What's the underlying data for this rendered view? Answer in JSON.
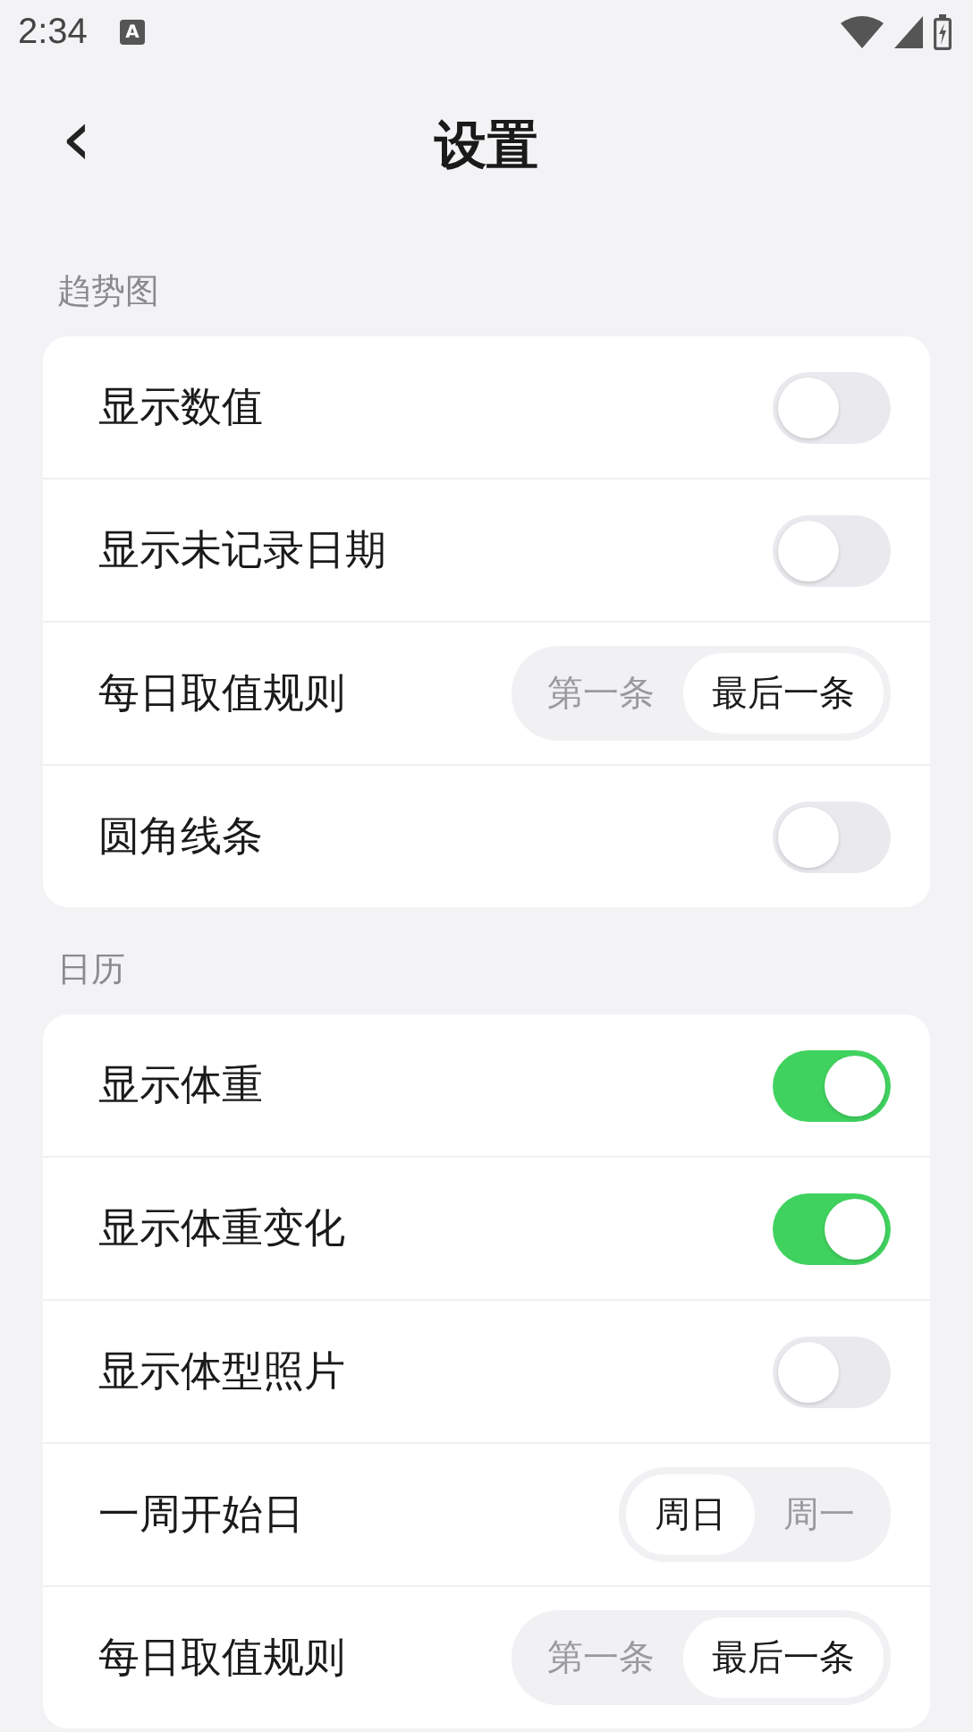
{
  "status_bar": {
    "time": "2:34",
    "notice_letter": "A"
  },
  "header": {
    "back": "‹",
    "title": "设置"
  },
  "sections": [
    {
      "title": "趋势图",
      "rows": [
        {
          "kind": "toggle",
          "label": "显示数值",
          "on": false
        },
        {
          "kind": "toggle",
          "label": "显示未记录日期",
          "on": false
        },
        {
          "kind": "segment",
          "label": "每日取值规则",
          "options": [
            {
              "label": "第一条",
              "selected": false
            },
            {
              "label": "最后一条",
              "selected": true
            }
          ]
        },
        {
          "kind": "toggle",
          "label": "圆角线条",
          "on": false
        }
      ]
    },
    {
      "title": "日历",
      "rows": [
        {
          "kind": "toggle",
          "label": "显示体重",
          "on": true
        },
        {
          "kind": "toggle",
          "label": "显示体重变化",
          "on": true
        },
        {
          "kind": "toggle",
          "label": "显示体型照片",
          "on": false
        },
        {
          "kind": "segment",
          "label": "一周开始日",
          "options": [
            {
              "label": "周日",
              "selected": true
            },
            {
              "label": "周一",
              "selected": false
            }
          ]
        },
        {
          "kind": "segment",
          "label": "每日取值规则",
          "options": [
            {
              "label": "第一条",
              "selected": false
            },
            {
              "label": "最后一条",
              "selected": true
            }
          ]
        }
      ]
    }
  ]
}
